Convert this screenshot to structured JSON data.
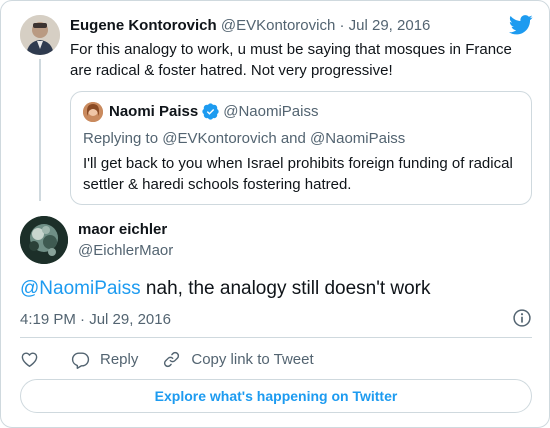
{
  "tweet": {
    "author_name": "Eugene Kontorovich",
    "author_handle": "@EVKontorovich",
    "separator": "·",
    "date": "Jul 29, 2016",
    "text": "For this analogy to work, u must be saying that mosques in France are radical & foster hatred. Not very progressive!"
  },
  "quoted_tweet": {
    "author_name": "Naomi Paiss",
    "author_handle": "@NaomiPaiss",
    "verified": true,
    "reply_prefix": "Replying to",
    "reply_handle_1": "@EVKontorovich",
    "reply_and": "and",
    "reply_handle_2": "@NaomiPaiss",
    "text": "I'll get back to you when Israel prohibits foreign funding of radical settler & haredi schools fostering hatred."
  },
  "reply": {
    "author_name": "maor eichler",
    "author_handle": "@EichlerMaor",
    "mention": "@NaomiPaiss",
    "text": " nah, the analogy still doesn't work",
    "time": "4:19 PM",
    "separator": "·",
    "date": "Jul 29, 2016"
  },
  "actions": {
    "like_icon": "heart-icon",
    "reply_label": "Reply",
    "copy_label": "Copy link to Tweet"
  },
  "footer": {
    "explore_label": "Explore what's happening on Twitter"
  },
  "colors": {
    "accent": "#1d9bf0",
    "text": "#0f1419",
    "muted": "#536471",
    "border": "#cfd9de"
  }
}
